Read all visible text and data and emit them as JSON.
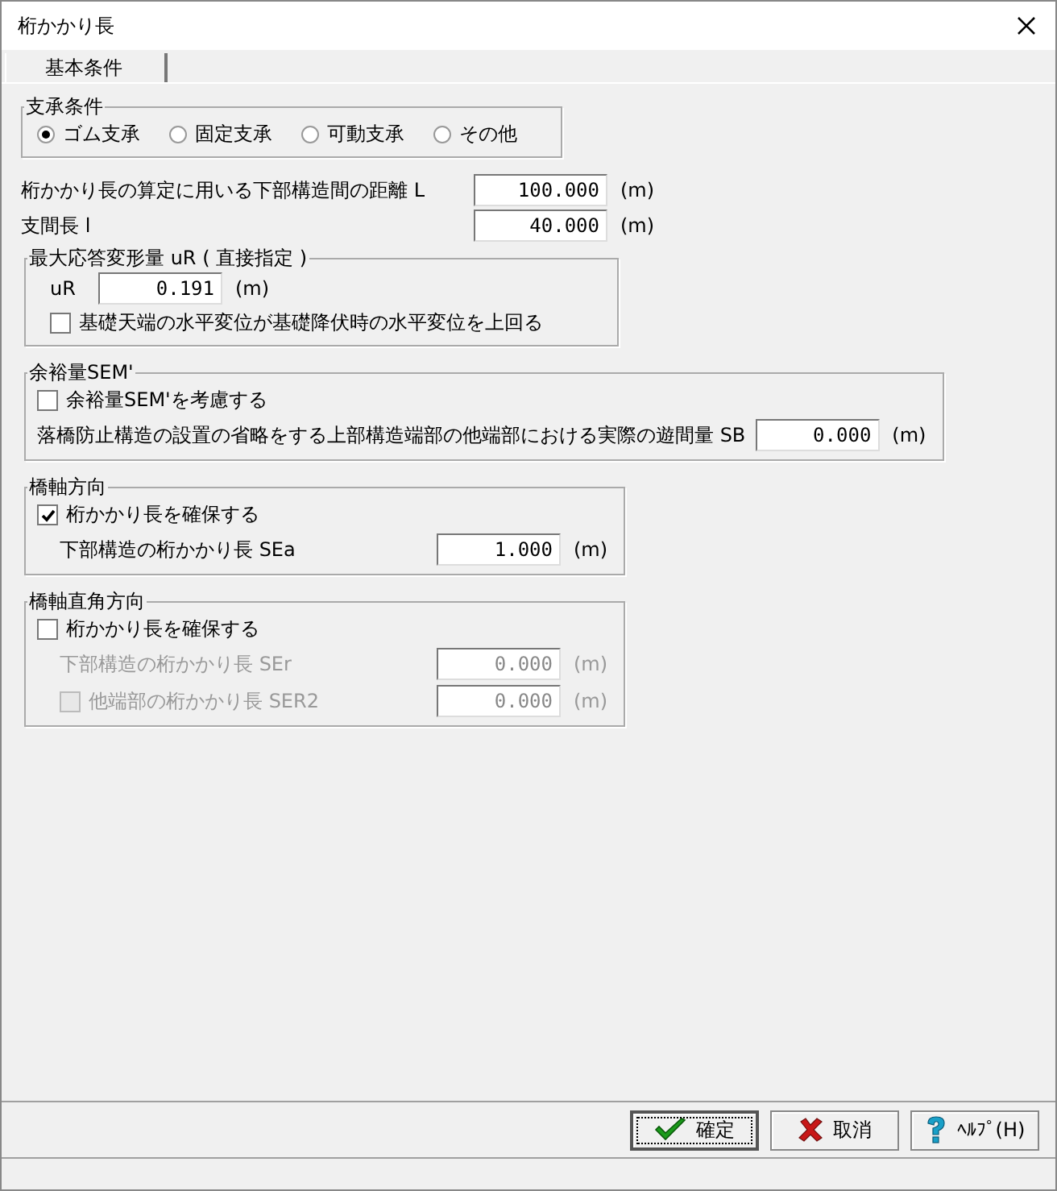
{
  "window": {
    "title": "桁かかり長"
  },
  "tabs": [
    {
      "label": "基本条件",
      "selected": true
    }
  ],
  "bearing": {
    "legend": "支承条件",
    "options": [
      {
        "label": "ゴム支承",
        "selected": true
      },
      {
        "label": "固定支承",
        "selected": false
      },
      {
        "label": "可動支承",
        "selected": false
      },
      {
        "label": "その他",
        "selected": false
      }
    ]
  },
  "distance": {
    "label": "桁かかり長の算定に用いる下部構造間の距離 L",
    "value": "100.000",
    "unit": "(m)"
  },
  "span": {
    "label": "支間長 l",
    "value": "40.000",
    "unit": "(m)"
  },
  "deformation": {
    "legend": "最大応答変形量 uR ( 直接指定 )",
    "label": "uR",
    "value": "0.191",
    "unit": "(m)",
    "check": {
      "label": "基礎天端の水平変位が基礎降伏時の水平変位を上回る",
      "checked": false
    }
  },
  "margin": {
    "legend": "余裕量SEM'",
    "check": {
      "label": "余裕量SEM'を考慮する",
      "checked": false
    },
    "label": "落橋防止構造の設置の省略をする上部構造端部の他端部における実際の遊間量  SB",
    "value": "0.000",
    "unit": "(m)"
  },
  "axial": {
    "legend": "橋軸方向",
    "check": {
      "label": "桁かかり長を確保する",
      "checked": true
    },
    "fields": [
      {
        "label": "下部構造の桁かかり長 SEa",
        "value": "1.000",
        "unit": "(m)",
        "disabled": false
      }
    ]
  },
  "perpendicular": {
    "legend": "橋軸直角方向",
    "check": {
      "label": "桁かかり長を確保する",
      "checked": false
    },
    "fields": [
      {
        "label": "下部構造の桁かかり長 SEr",
        "value": "0.000",
        "unit": "(m)",
        "disabled": true
      },
      {
        "kind": "check",
        "label": "他端部の桁かかり長 SER2",
        "checked": false,
        "value": "0.000",
        "unit": "(m)",
        "disabled": true
      }
    ]
  },
  "buttons": [
    {
      "kind": "ok",
      "label": "確定"
    },
    {
      "kind": "cancel",
      "label": "取消"
    },
    {
      "kind": "help",
      "label": "ﾍﾙﾌﾟ(H)"
    }
  ]
}
